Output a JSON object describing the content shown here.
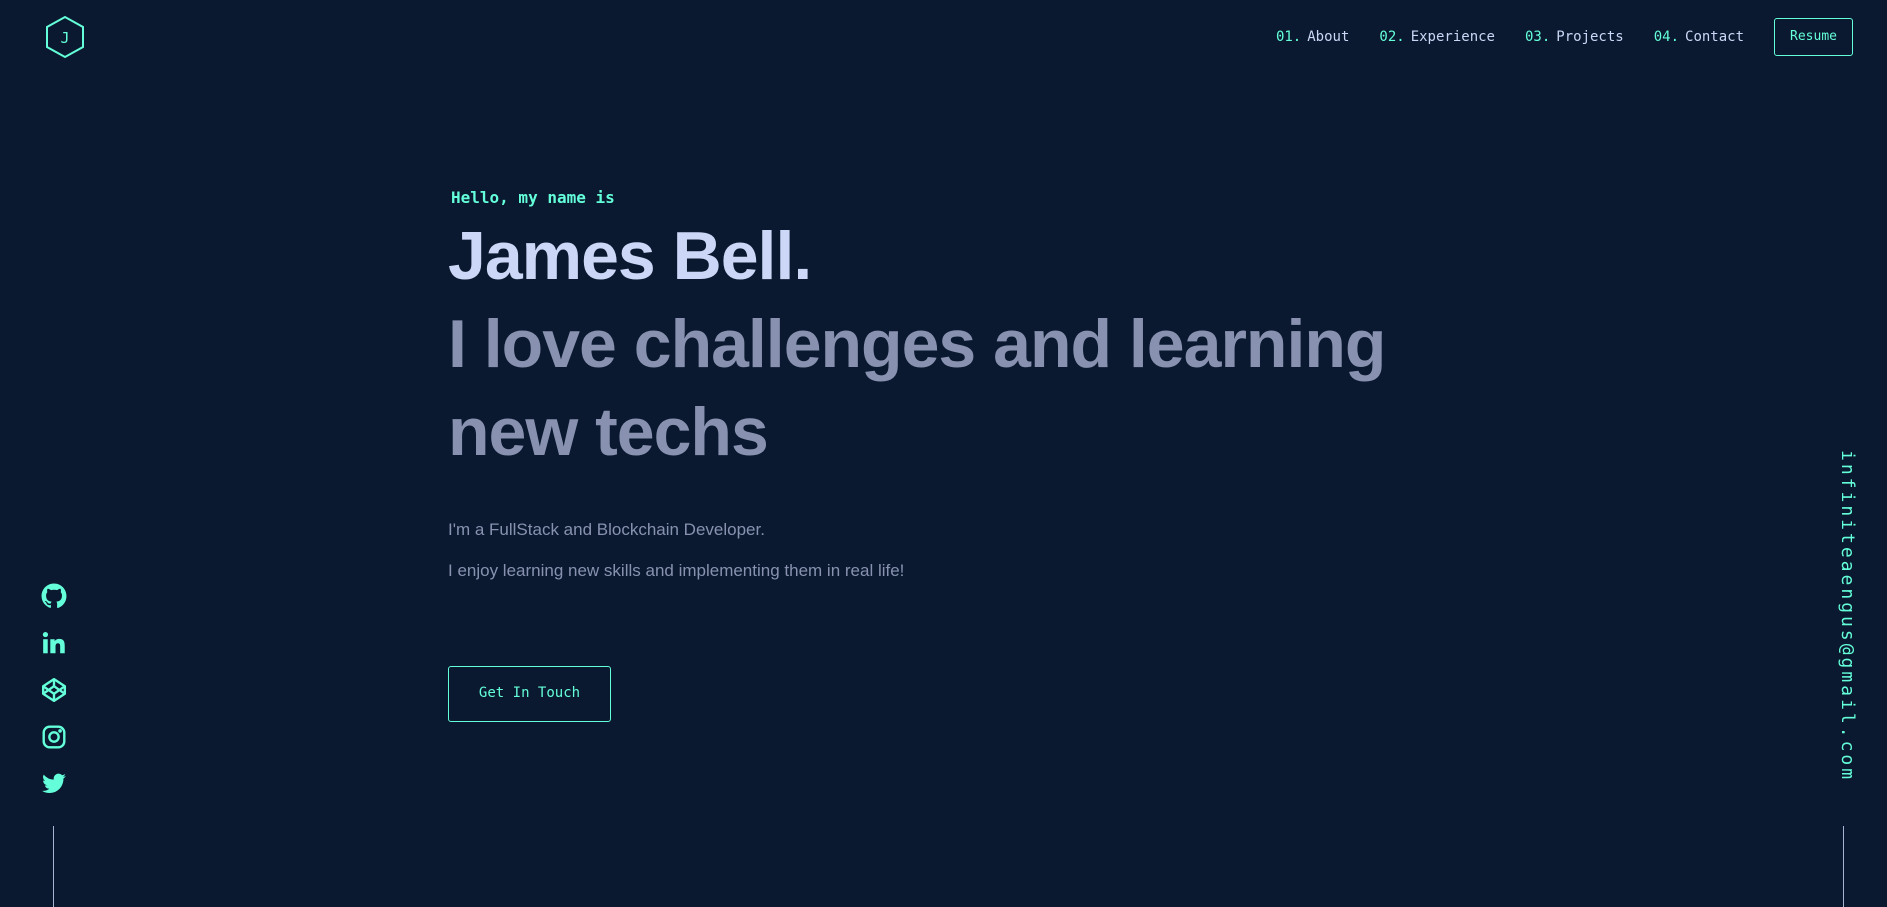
{
  "logo": {
    "letter": "J",
    "icon": "hexagon-logo-icon"
  },
  "nav": {
    "items": [
      {
        "num": "01.",
        "label": "About"
      },
      {
        "num": "02.",
        "label": "Experience"
      },
      {
        "num": "03.",
        "label": "Projects"
      },
      {
        "num": "04.",
        "label": "Contact"
      }
    ],
    "resume_label": "Resume"
  },
  "hero": {
    "greeting": "Hello, my name is",
    "name": "James Bell.",
    "tagline": "I love challenges and learning new techs",
    "intro": [
      "I'm a FullStack and Blockchain Developer.",
      "I enjoy learning new skills and implementing them in real life!"
    ],
    "cta_label": "Get In Touch"
  },
  "social": {
    "icons": [
      "github-icon",
      "linkedin-icon",
      "codepen-icon",
      "instagram-icon",
      "twitter-icon"
    ]
  },
  "email": "infiniteaengus@gmail.com",
  "colors": {
    "background": "#0a192f",
    "accent": "#64ffda",
    "heading": "#ccd6f6",
    "text": "#8892b0",
    "line": "#a8b2d1"
  }
}
